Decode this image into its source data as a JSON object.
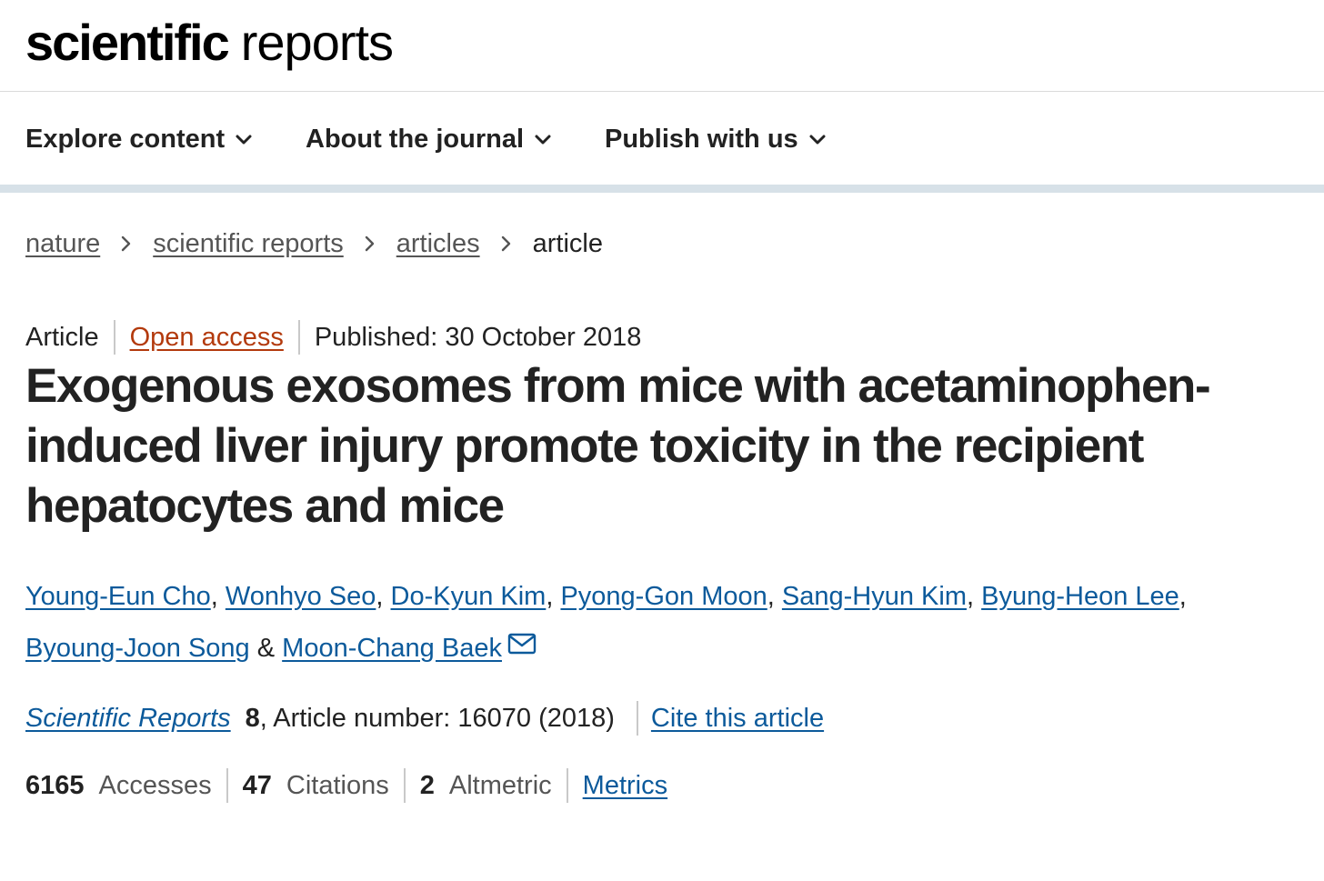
{
  "logo": {
    "bold": "scientific",
    "light": "reports"
  },
  "nav": {
    "items": [
      {
        "label": "Explore content"
      },
      {
        "label": "About the journal"
      },
      {
        "label": "Publish with us"
      }
    ]
  },
  "breadcrumb": {
    "items": [
      "nature",
      "scientific reports",
      "articles"
    ],
    "current": "article"
  },
  "meta": {
    "type": "Article",
    "access": "Open access",
    "published": "Published: 30 October 2018"
  },
  "title": "Exogenous exosomes from mice with acetaminophen-induced liver injury promote toxicity in the recipient hepatocytes and mice",
  "authors": [
    "Young-Eun Cho",
    "Wonhyo Seo",
    "Do-Kyun Kim",
    "Pyong-Gon Moon",
    "Sang-Hyun Kim",
    "Byung-Heon Lee",
    "Byoung-Joon Song",
    "Moon-Chang Baek"
  ],
  "author_separators": {
    "comma": ",",
    "amp": " & "
  },
  "citation": {
    "journal": "Scientific Reports",
    "volume": "8",
    "details": ", Article number: 16070 (2018)",
    "cite_link": "Cite this article"
  },
  "metrics": {
    "accesses_value": "6165",
    "accesses_label": "Accesses",
    "citations_value": "47",
    "citations_label": "Citations",
    "altmetric_value": "2",
    "altmetric_label": "Altmetric",
    "metrics_link": "Metrics"
  },
  "colors": {
    "link": "#0c5a9b",
    "open_access": "#b33a0d",
    "nav_rule": "#d7e1e8"
  },
  "icons": {
    "nav_chevron": "chevron-down-icon",
    "breadcrumb_sep": "chevron-right-icon",
    "corresponding": "mail-icon"
  }
}
